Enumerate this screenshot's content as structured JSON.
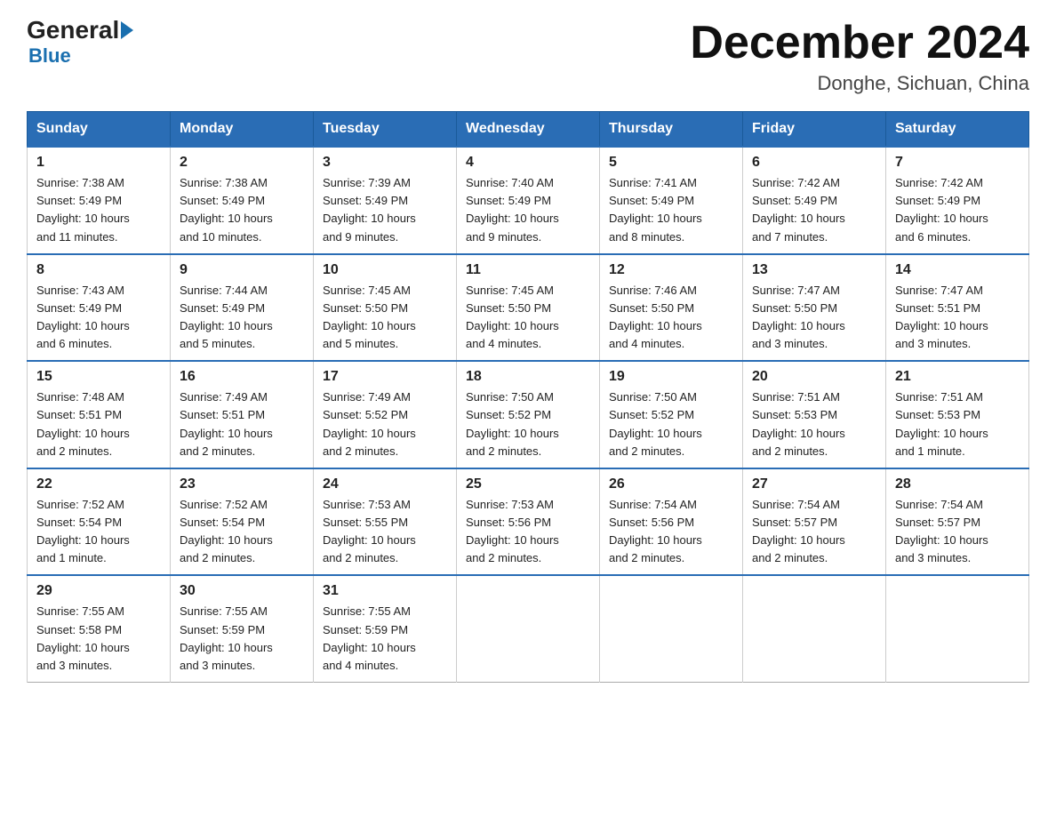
{
  "header": {
    "logo_general": "General",
    "logo_blue": "Blue",
    "title": "December 2024",
    "subtitle": "Donghe, Sichuan, China"
  },
  "weekdays": [
    "Sunday",
    "Monday",
    "Tuesday",
    "Wednesday",
    "Thursday",
    "Friday",
    "Saturday"
  ],
  "weeks": [
    [
      {
        "day": "1",
        "sunrise": "7:38 AM",
        "sunset": "5:49 PM",
        "daylight": "10 hours and 11 minutes."
      },
      {
        "day": "2",
        "sunrise": "7:38 AM",
        "sunset": "5:49 PM",
        "daylight": "10 hours and 10 minutes."
      },
      {
        "day": "3",
        "sunrise": "7:39 AM",
        "sunset": "5:49 PM",
        "daylight": "10 hours and 9 minutes."
      },
      {
        "day": "4",
        "sunrise": "7:40 AM",
        "sunset": "5:49 PM",
        "daylight": "10 hours and 9 minutes."
      },
      {
        "day": "5",
        "sunrise": "7:41 AM",
        "sunset": "5:49 PM",
        "daylight": "10 hours and 8 minutes."
      },
      {
        "day": "6",
        "sunrise": "7:42 AM",
        "sunset": "5:49 PM",
        "daylight": "10 hours and 7 minutes."
      },
      {
        "day": "7",
        "sunrise": "7:42 AM",
        "sunset": "5:49 PM",
        "daylight": "10 hours and 6 minutes."
      }
    ],
    [
      {
        "day": "8",
        "sunrise": "7:43 AM",
        "sunset": "5:49 PM",
        "daylight": "10 hours and 6 minutes."
      },
      {
        "day": "9",
        "sunrise": "7:44 AM",
        "sunset": "5:49 PM",
        "daylight": "10 hours and 5 minutes."
      },
      {
        "day": "10",
        "sunrise": "7:45 AM",
        "sunset": "5:50 PM",
        "daylight": "10 hours and 5 minutes."
      },
      {
        "day": "11",
        "sunrise": "7:45 AM",
        "sunset": "5:50 PM",
        "daylight": "10 hours and 4 minutes."
      },
      {
        "day": "12",
        "sunrise": "7:46 AM",
        "sunset": "5:50 PM",
        "daylight": "10 hours and 4 minutes."
      },
      {
        "day": "13",
        "sunrise": "7:47 AM",
        "sunset": "5:50 PM",
        "daylight": "10 hours and 3 minutes."
      },
      {
        "day": "14",
        "sunrise": "7:47 AM",
        "sunset": "5:51 PM",
        "daylight": "10 hours and 3 minutes."
      }
    ],
    [
      {
        "day": "15",
        "sunrise": "7:48 AM",
        "sunset": "5:51 PM",
        "daylight": "10 hours and 2 minutes."
      },
      {
        "day": "16",
        "sunrise": "7:49 AM",
        "sunset": "5:51 PM",
        "daylight": "10 hours and 2 minutes."
      },
      {
        "day": "17",
        "sunrise": "7:49 AM",
        "sunset": "5:52 PM",
        "daylight": "10 hours and 2 minutes."
      },
      {
        "day": "18",
        "sunrise": "7:50 AM",
        "sunset": "5:52 PM",
        "daylight": "10 hours and 2 minutes."
      },
      {
        "day": "19",
        "sunrise": "7:50 AM",
        "sunset": "5:52 PM",
        "daylight": "10 hours and 2 minutes."
      },
      {
        "day": "20",
        "sunrise": "7:51 AM",
        "sunset": "5:53 PM",
        "daylight": "10 hours and 2 minutes."
      },
      {
        "day": "21",
        "sunrise": "7:51 AM",
        "sunset": "5:53 PM",
        "daylight": "10 hours and 1 minute."
      }
    ],
    [
      {
        "day": "22",
        "sunrise": "7:52 AM",
        "sunset": "5:54 PM",
        "daylight": "10 hours and 1 minute."
      },
      {
        "day": "23",
        "sunrise": "7:52 AM",
        "sunset": "5:54 PM",
        "daylight": "10 hours and 2 minutes."
      },
      {
        "day": "24",
        "sunrise": "7:53 AM",
        "sunset": "5:55 PM",
        "daylight": "10 hours and 2 minutes."
      },
      {
        "day": "25",
        "sunrise": "7:53 AM",
        "sunset": "5:56 PM",
        "daylight": "10 hours and 2 minutes."
      },
      {
        "day": "26",
        "sunrise": "7:54 AM",
        "sunset": "5:56 PM",
        "daylight": "10 hours and 2 minutes."
      },
      {
        "day": "27",
        "sunrise": "7:54 AM",
        "sunset": "5:57 PM",
        "daylight": "10 hours and 2 minutes."
      },
      {
        "day": "28",
        "sunrise": "7:54 AM",
        "sunset": "5:57 PM",
        "daylight": "10 hours and 3 minutes."
      }
    ],
    [
      {
        "day": "29",
        "sunrise": "7:55 AM",
        "sunset": "5:58 PM",
        "daylight": "10 hours and 3 minutes."
      },
      {
        "day": "30",
        "sunrise": "7:55 AM",
        "sunset": "5:59 PM",
        "daylight": "10 hours and 3 minutes."
      },
      {
        "day": "31",
        "sunrise": "7:55 AM",
        "sunset": "5:59 PM",
        "daylight": "10 hours and 4 minutes."
      },
      null,
      null,
      null,
      null
    ]
  ],
  "labels": {
    "sunrise": "Sunrise:",
    "sunset": "Sunset:",
    "daylight": "Daylight:"
  }
}
